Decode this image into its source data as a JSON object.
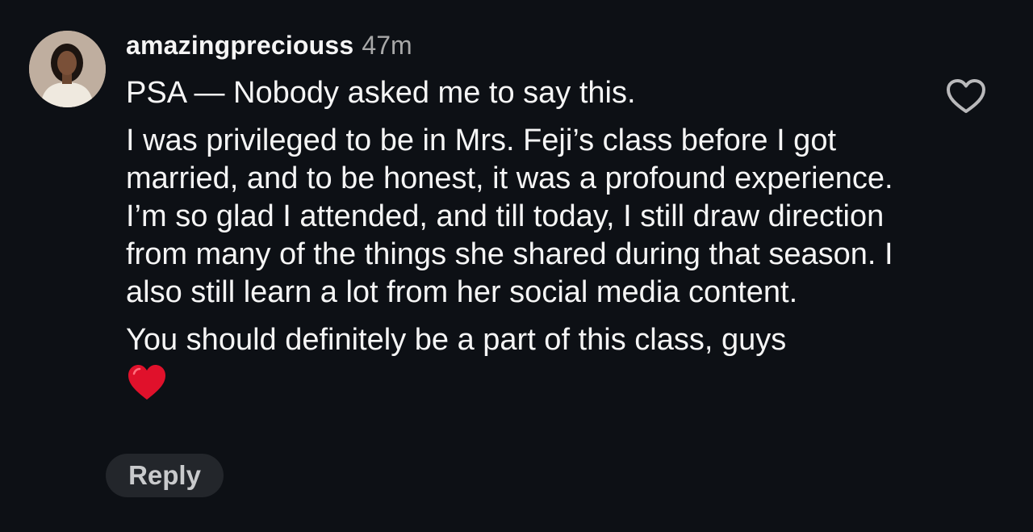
{
  "comment": {
    "username": "amazingpreciouss",
    "time": "47m",
    "paragraphs": [
      "PSA — Nobody asked me to say this.",
      "I was privileged to be in Mrs. Feji’s class before I got married, and to be honest, it was a profound experience. I’m so glad I attended, and till today, I still draw direction from many of the things she shared during that season. I also still learn a lot from her social media content.",
      "You should definitely be a part of this class, guys"
    ],
    "reply_label": "Reply"
  },
  "icons": {
    "like": "heart-outline-icon",
    "emoji": "red-heart-emoji"
  },
  "colors": {
    "background": "#0d1015",
    "text": "#f5f5f5",
    "secondary_text": "#a8a8a8",
    "reply_bg": "#23262b",
    "emoji_red": "#e0112b"
  }
}
